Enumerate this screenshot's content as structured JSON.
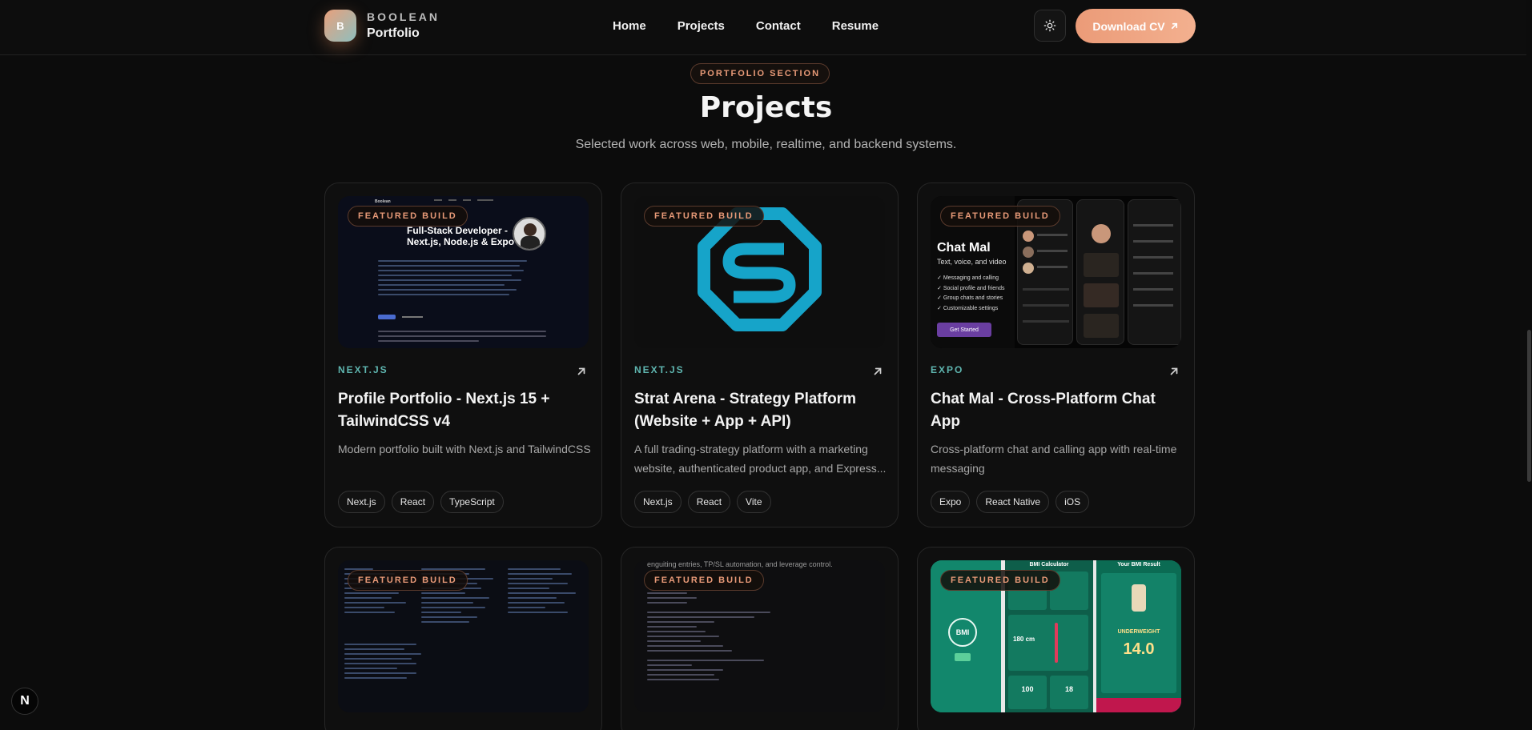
{
  "nav": {
    "brand_badge": "B",
    "brand_top": "BOOLEAN",
    "brand_bottom": "Portfolio",
    "links": [
      "Home",
      "Projects",
      "Contact",
      "Resume"
    ],
    "theme_icon": "sun-icon",
    "download_label": "Download CV",
    "download_icon": "arrow-up-right-icon"
  },
  "section": {
    "tag": "PORTFOLIO SECTION",
    "title": "Projects",
    "subtitle": "Selected work across web, mobile, realtime, and backend systems."
  },
  "badge_label": "FEATURED BUILD",
  "projects": [
    {
      "category": "NEXT.JS",
      "title": "Profile Portfolio - Next.js 15 + TailwindCSS v4",
      "description": "Modern portfolio built with Next.js and TailwindCSS",
      "tags": [
        "Next.js",
        "React",
        "TypeScript"
      ],
      "thumb": {
        "headline": "Full-Stack Developer - Next.js, Node.js & Expo",
        "brand": "Boolean"
      }
    },
    {
      "category": "NEXT.JS",
      "title": "Strat Arena - Strategy Platform (Website + App + API)",
      "description": "A full trading-strategy platform with a marketing website, authenticated product app, and Express...",
      "tags": [
        "Next.js",
        "React",
        "Vite"
      ]
    },
    {
      "category": "EXPO",
      "title": "Chat Mal - Cross-Platform Chat App",
      "description": "Cross-platform chat and calling app with real-time messaging",
      "tags": [
        "Expo",
        "React Native",
        "iOS"
      ],
      "thumb": {
        "app_name": "Chat Mal",
        "tagline": "Text, voice, and video",
        "features": [
          "Messaging and calling",
          "Social profile and friends",
          "Group chats and stories",
          "Customizable settings"
        ],
        "cta": "Get Started"
      }
    }
  ],
  "row2": [
    {
      "thumb": "code-editor"
    },
    {
      "thumb": "python-code",
      "top_text": "enguiting entries, TP/SL automation, and leverage control."
    },
    {
      "thumb": "bmi-app",
      "screen1_title": "BMI Calculator",
      "screen2_title": "Your BMI Result",
      "bmi_label": "BMI",
      "result_value": "14.0",
      "result_label": "UNDERWEIGHT",
      "height_value": "180 cm",
      "weight_value": "100",
      "age_value": "18"
    }
  ],
  "next_badge": "N",
  "colors": {
    "accent": "#eb9b78",
    "teal": "#5fb6b0",
    "bg": "#0c0c0c"
  }
}
